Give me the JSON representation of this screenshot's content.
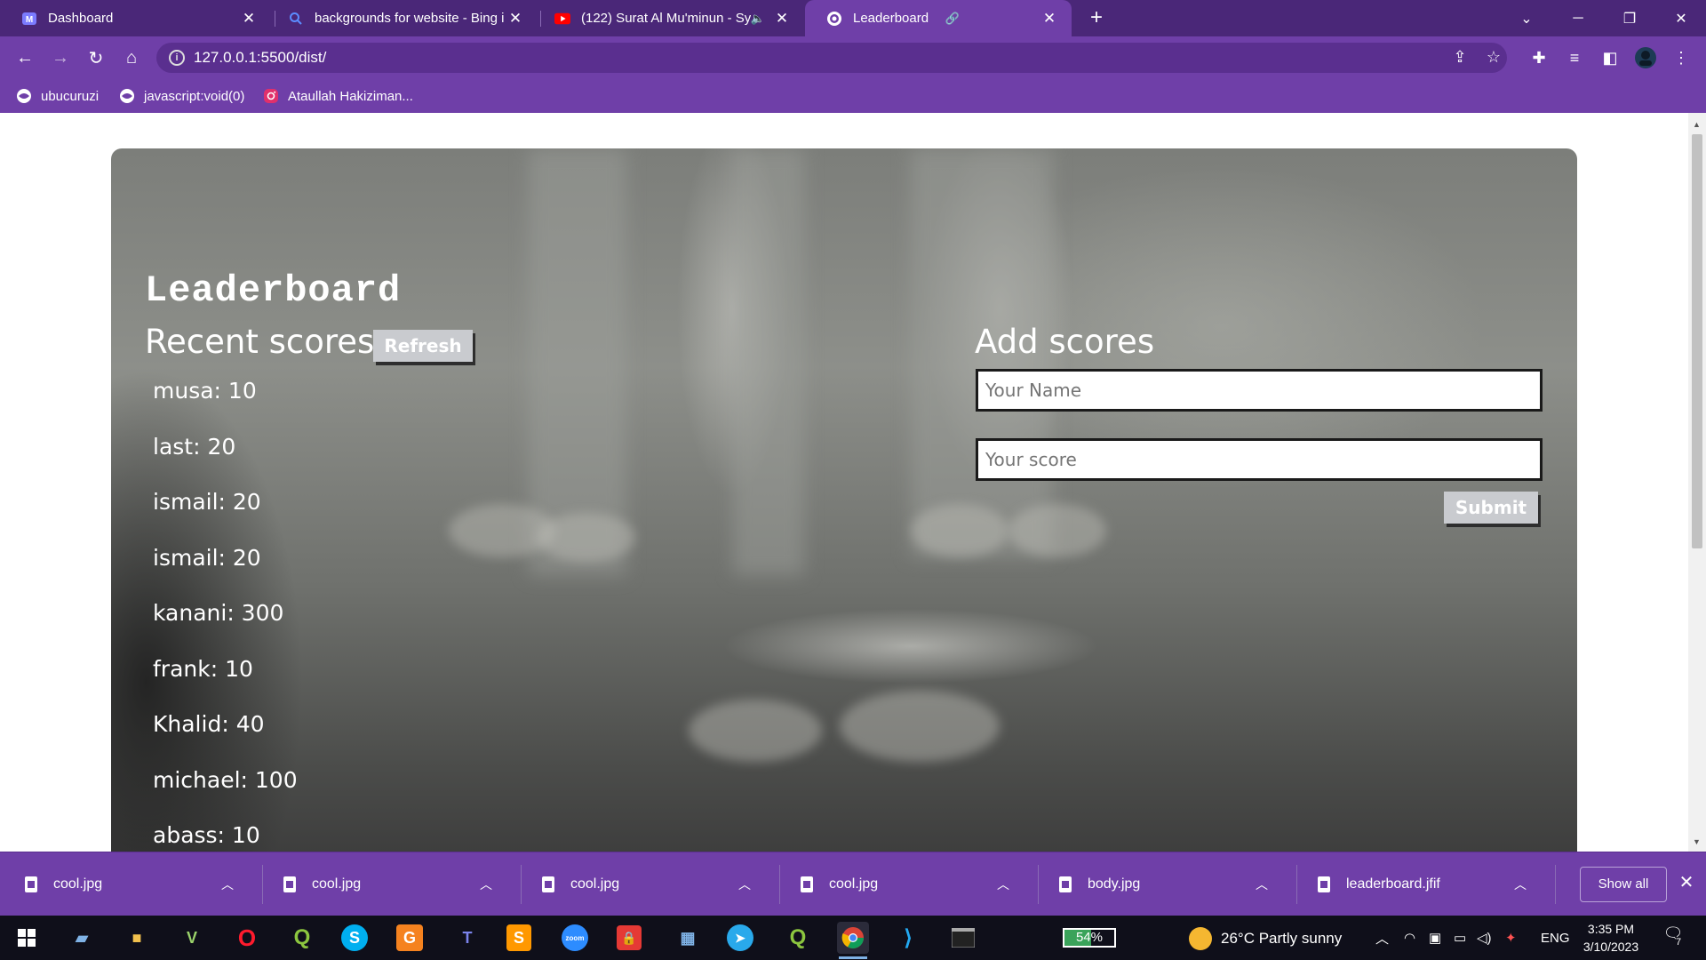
{
  "browser": {
    "tabs": [
      {
        "title": "Dashboard",
        "icon": "dashboard-icon",
        "active": false
      },
      {
        "title": "backgrounds for website - Bing i",
        "icon": "search-icon",
        "active": false
      },
      {
        "title": "(122) Surat Al Mu'minun - Sy",
        "icon": "youtube-icon",
        "active": false
      },
      {
        "title": "Leaderboard",
        "icon": "globe-icon",
        "active": true
      }
    ],
    "url": "127.0.0.1:5500/dist/",
    "bookmarks": [
      {
        "label": "ubucuruzi",
        "icon": "globe-icon"
      },
      {
        "label": "javascript:void(0)",
        "icon": "globe-icon"
      },
      {
        "label": "Ataullah Hakiziman...",
        "icon": "instagram-icon"
      }
    ]
  },
  "page": {
    "title": "Leaderboard",
    "recent_heading": "Recent scores",
    "refresh_label": "Refresh",
    "scores": [
      "musa: 10",
      "last: 20",
      "ismail: 20",
      "ismail: 20",
      "kanani: 300",
      "frank: 10",
      "Khalid: 40",
      "michael: 100",
      "abass: 10"
    ],
    "add_heading": "Add scores",
    "name_placeholder": "Your Name",
    "score_placeholder": "Your score",
    "submit_label": "Submit"
  },
  "downloads": {
    "items": [
      "cool.jpg",
      "cool.jpg",
      "cool.jpg",
      "cool.jpg",
      "body.jpg",
      "leaderboard.jfif"
    ],
    "show_all": "Show all"
  },
  "taskbar": {
    "battery": "54%",
    "battery_level": 0.54,
    "weather": "26°C  Partly sunny",
    "language": "ENG",
    "time": "3:35 PM",
    "date": "3/10/2023",
    "notifications": "7"
  }
}
